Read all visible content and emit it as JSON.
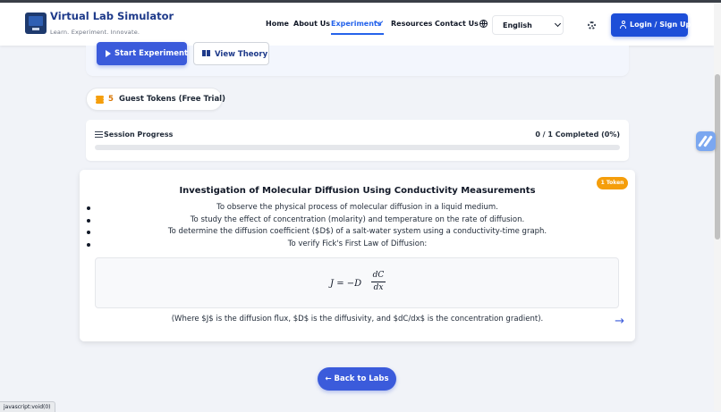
{
  "brand": {
    "title": "Virtual Lab Simulator",
    "tagline": "Learn. Experiment. Innovate."
  },
  "nav": {
    "items": [
      {
        "label": "Home"
      },
      {
        "label": "About Us"
      },
      {
        "label": "Experiments",
        "active": true
      },
      {
        "label": "Resources"
      },
      {
        "label": "Contact Us"
      }
    ],
    "language": "English",
    "login_label": "Login / Sign Up"
  },
  "actions": {
    "start_label": "Start Experiment",
    "theory_label": "View Theory"
  },
  "tokens": {
    "count": "5",
    "label": "Guest Tokens (Free Trial)"
  },
  "progress": {
    "label": "Session Progress",
    "value_text": "0 / 1 Completed (0%)",
    "fraction": 0
  },
  "experiment": {
    "badge": "1 Token",
    "title": "Investigation of Molecular Diffusion Using Conductivity Measurements",
    "objectives": [
      "To observe the physical process of molecular diffusion in a liquid medium.",
      "To study the effect of concentration (molarity) and temperature on the rate of diffusion.",
      "To determine the diffusion coefficient ($D$) of a salt-water system using a conductivity-time graph.",
      "To verify Fick's First Law of Diffusion:"
    ],
    "equation": {
      "lhs": "J = −D",
      "numerator": "dC",
      "denominator": "dx"
    },
    "footnote": "(Where $J$ is the diffusion flux, $D$ is the diffusivity, and $dC/dx$ is the concentration gradient).",
    "next_arrow": "→"
  },
  "back_label": "← Back to Labs",
  "status_bar": "javascript:void(0)",
  "colors": {
    "primary": "#3b5bdb",
    "nav_active": "#2563eb",
    "login_button": "#1d4ed8",
    "token_badge": "#f59e0b",
    "brand_title": "#1e3a8a"
  },
  "icons": [
    "monitor-logo-icon",
    "chevron-down-icon",
    "globe-icon",
    "gear-icon",
    "user-icon",
    "play-icon",
    "book-icon",
    "coins-icon",
    "list-icon",
    "arrow-right-icon",
    "widget-icon"
  ]
}
